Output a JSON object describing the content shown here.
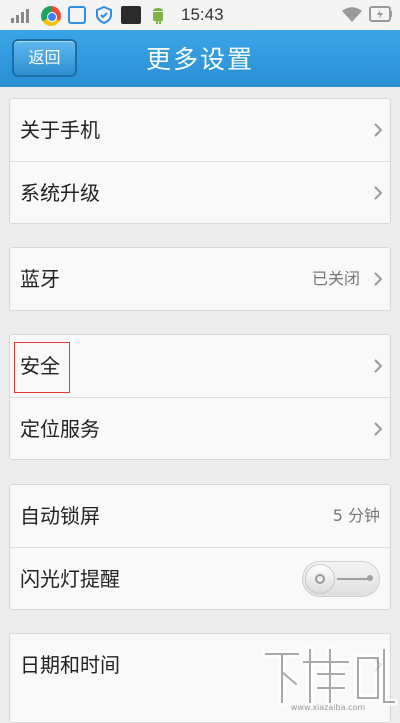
{
  "status_bar": {
    "time": "15:43",
    "icons": [
      "signal-icon",
      "chrome-icon",
      "gallery-icon",
      "shield-icon",
      "bag-icon",
      "android-icon",
      "wifi-icon",
      "battery-icon"
    ]
  },
  "header": {
    "back_label": "返回",
    "title": "更多设置"
  },
  "groups": [
    {
      "rows": [
        {
          "label": "关于手机"
        },
        {
          "label": "系统升级"
        }
      ]
    },
    {
      "rows": [
        {
          "label": "蓝牙",
          "value": "已关闭"
        }
      ]
    },
    {
      "rows": [
        {
          "label": "安全",
          "highlighted": true
        },
        {
          "label": "定位服务"
        }
      ]
    },
    {
      "rows": [
        {
          "label": "自动锁屏",
          "value": "5 分钟"
        },
        {
          "label": "闪光灯提醒",
          "toggle": "off"
        }
      ]
    },
    {
      "rows": [
        {
          "label": "日期和时间"
        }
      ]
    }
  ],
  "watermark": {
    "text": "下载吧",
    "url": "www.xiazaiba.com"
  },
  "colors": {
    "header_blue": "#2f97da",
    "background": "#ececec",
    "highlight_red": "#e53935"
  }
}
